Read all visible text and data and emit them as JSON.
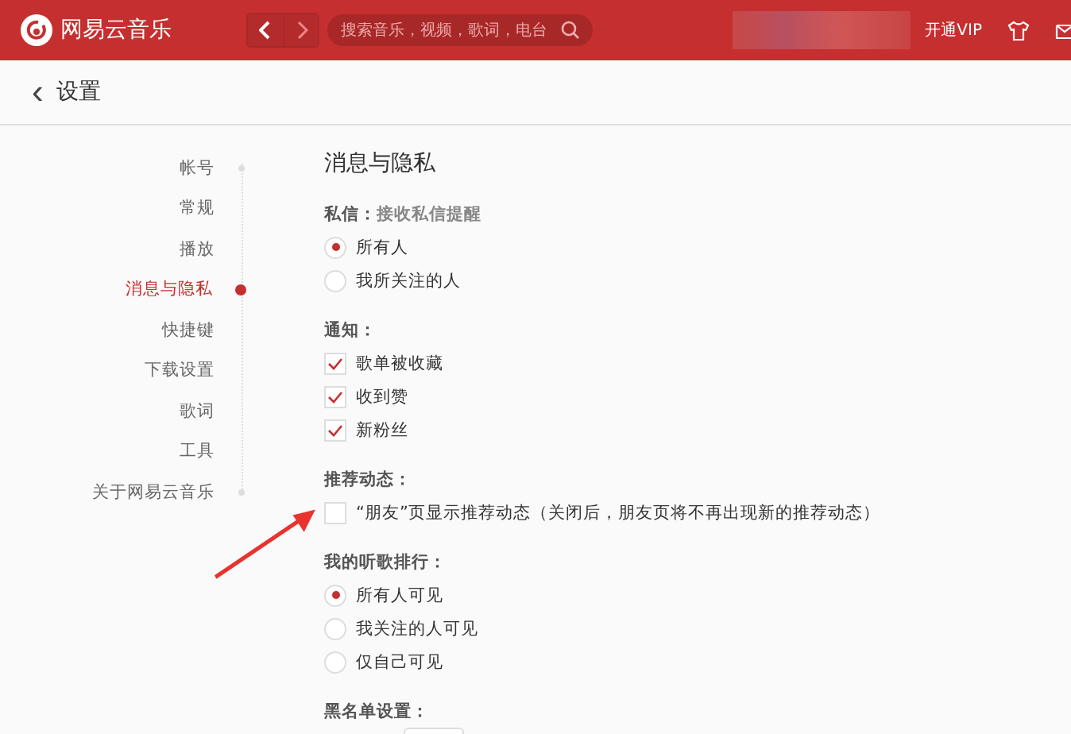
{
  "topbar": {
    "app_name": "网易云音乐",
    "search": {
      "placeholder": "搜索音乐，视频，歌词，电台"
    },
    "vip_link": "开通VIP"
  },
  "page": {
    "title": "设置",
    "back_icon": "‹"
  },
  "sidebar": {
    "items": [
      {
        "label": "帐号",
        "selected": false
      },
      {
        "label": "常规",
        "selected": false
      },
      {
        "label": "播放",
        "selected": false
      },
      {
        "label": "消息与隐私",
        "selected": true
      },
      {
        "label": "快捷键",
        "selected": false
      },
      {
        "label": "下载设置",
        "selected": false
      },
      {
        "label": "歌词",
        "selected": false
      },
      {
        "label": "工具",
        "selected": false
      },
      {
        "label": "关于网易云音乐",
        "selected": false
      }
    ]
  },
  "content": {
    "title": "消息与隐私",
    "sections": [
      {
        "label": "私信：",
        "note": "接收私信提醒",
        "kind": "radio",
        "options": [
          {
            "label": "所有人",
            "selected": true
          },
          {
            "label": "我所关注的人",
            "selected": false
          }
        ]
      },
      {
        "label": "通知：",
        "kind": "checkbox",
        "options": [
          {
            "label": "歌单被收藏",
            "checked": true
          },
          {
            "label": "收到赞",
            "checked": true
          },
          {
            "label": "新粉丝",
            "checked": true
          }
        ]
      },
      {
        "label": "推荐动态：",
        "kind": "checkbox",
        "options": [
          {
            "label": "“朋友”页显示推荐动态（关闭后，朋友页将不再出现新的推荐动态）",
            "checked": false
          }
        ]
      },
      {
        "label": "我的听歌排行：",
        "kind": "radio",
        "options": [
          {
            "label": "所有人可见",
            "selected": true
          },
          {
            "label": "我关注的人可见",
            "selected": false
          },
          {
            "label": "仅自己可见",
            "selected": false
          }
        ]
      },
      {
        "label": "黑名单设置：",
        "kind": "button_stub"
      }
    ]
  }
}
